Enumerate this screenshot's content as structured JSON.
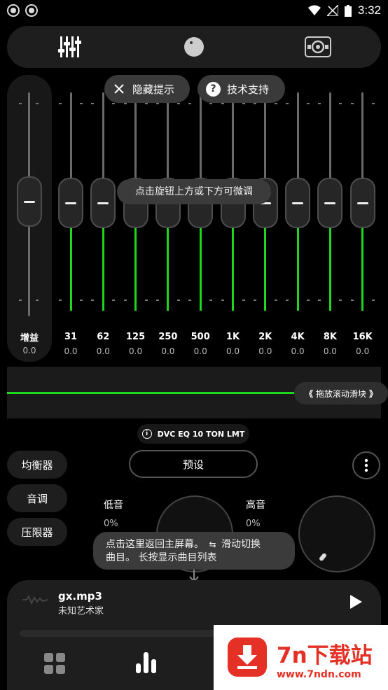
{
  "status_bar": {
    "time": "3:32"
  },
  "top_nav": {
    "icons": [
      "equalizer-sliders-icon",
      "knob-icon",
      "speaker-icon"
    ]
  },
  "hint_buttons": {
    "hide_tips": "隐藏提示",
    "tech_support": "技术支持"
  },
  "tooltips": {
    "fine_tune": "点击旋钮上方或下方可微调",
    "home_line1_a": "点击这里返回主屏幕。",
    "home_line1_b": "滑动切换",
    "home_line2": "曲目。 长按显示曲目列表"
  },
  "gain": {
    "label": "增益",
    "value": "0.0"
  },
  "eq_bands": [
    {
      "freq": "31",
      "value": "0.0"
    },
    {
      "freq": "62",
      "value": "0.0"
    },
    {
      "freq": "125",
      "value": "0.0"
    },
    {
      "freq": "250",
      "value": "0.0"
    },
    {
      "freq": "500",
      "value": "0.0"
    },
    {
      "freq": "1K",
      "value": "0.0"
    },
    {
      "freq": "2K",
      "value": "0.0"
    },
    {
      "freq": "4K",
      "value": "0.0"
    },
    {
      "freq": "8K",
      "value": "0.0"
    },
    {
      "freq": "16K",
      "value": "0.0"
    }
  ],
  "scroll_hint": "拖放滚动滑块",
  "preset_name": "DVC EQ 10 TON LMT",
  "side_tabs": [
    "均衡器",
    "音调",
    "压限器"
  ],
  "preset_button": "预设",
  "tone": {
    "bass_label": "低音",
    "bass_value": "0%",
    "treble_label": "高音",
    "treble_value": "0%"
  },
  "player": {
    "track": "gx.mp3",
    "artist": "未知艺术家"
  },
  "watermark": {
    "title": "7n下载站",
    "url": "www.7ndn.com"
  },
  "colors": {
    "accent_green": "#1fd61f",
    "watermark_red": "#e53026"
  }
}
